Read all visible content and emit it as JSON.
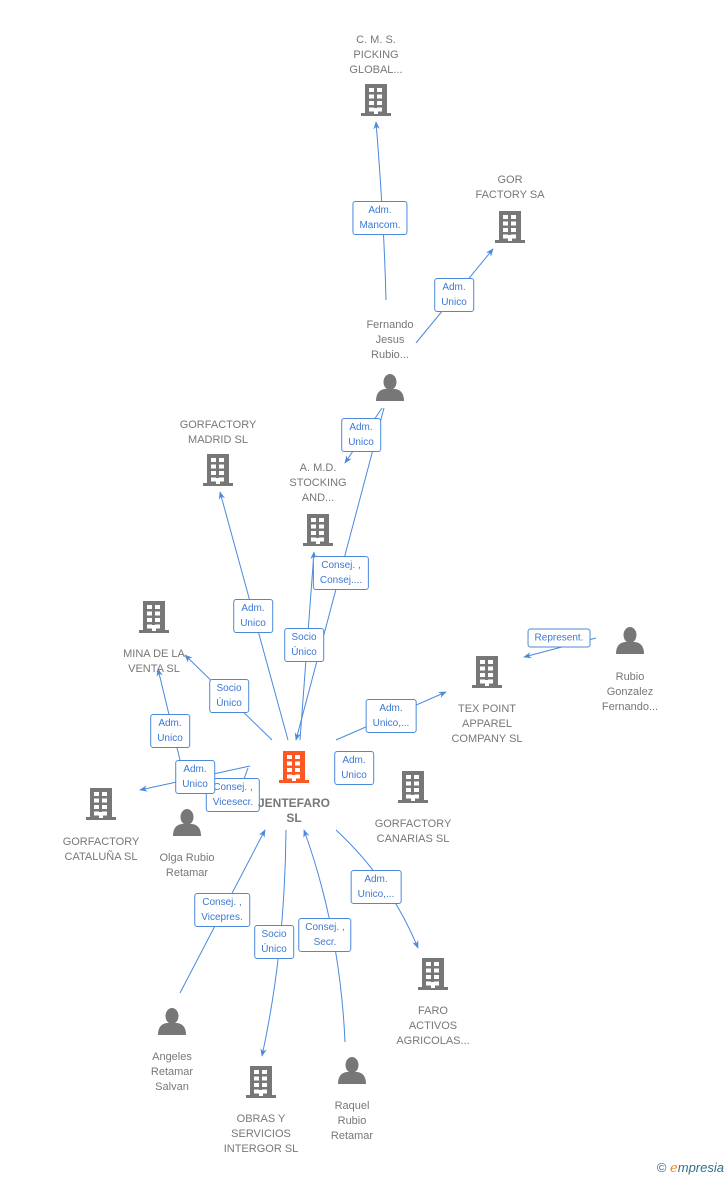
{
  "colors": {
    "edge": "#4a89dc",
    "node": "#777777",
    "center": "#ff5722"
  },
  "nodes": [
    {
      "label": "JENTEFARO\nSL",
      "type": "company",
      "icon": "building-icon",
      "center": true
    },
    {
      "label": "C.  M. S.\nPICKING\nGLOBAL...",
      "type": "company",
      "icon": "building-icon"
    },
    {
      "label": "GOR\nFACTORY SA",
      "type": "company",
      "icon": "building-icon"
    },
    {
      "label": "Fernando\nJesus\nRubio...",
      "type": "person",
      "icon": "person-icon"
    },
    {
      "label": "GORFACTORY\nMADRID  SL",
      "type": "company",
      "icon": "building-icon"
    },
    {
      "label": "A. M.D.\nSTOCKING\nAND...",
      "type": "company",
      "icon": "building-icon"
    },
    {
      "label": "MINA DE LA\nVENTA SL",
      "type": "company",
      "icon": "building-icon"
    },
    {
      "label": "TEX POINT\nAPPAREL\nCOMPANY  SL",
      "type": "company",
      "icon": "building-icon"
    },
    {
      "label": "Rubio\nGonzalez\nFernando...",
      "type": "person",
      "icon": "person-icon"
    },
    {
      "label": "GORFACTORY\nCATALUÑA  SL",
      "type": "company",
      "icon": "building-icon"
    },
    {
      "label": "Olga Rubio\nRetamar",
      "type": "person",
      "icon": "person-icon"
    },
    {
      "label": "GORFACTORY\nCANARIAS  SL",
      "type": "company",
      "icon": "building-icon"
    },
    {
      "label": "FARO\nACTIVOS\nAGRICOLAS...",
      "type": "company",
      "icon": "building-icon"
    },
    {
      "label": "Angeles\nRetamar\nSalvan",
      "type": "person",
      "icon": "person-icon"
    },
    {
      "label": "OBRAS Y\nSERVICIOS\nINTERGOR  SL",
      "type": "company",
      "icon": "building-icon"
    },
    {
      "label": "Raquel\nRubio\nRetamar",
      "type": "person",
      "icon": "person-icon"
    }
  ],
  "edges": [
    {
      "label": "Adm.\nMancom."
    },
    {
      "label": "Adm.\nUnico"
    },
    {
      "label": "Adm.\nUnico"
    },
    {
      "label": "Consej. ,\nConsej...."
    },
    {
      "label": "Adm.\nUnico"
    },
    {
      "label": "Socio\nÚnico"
    },
    {
      "label": "Socio\nÚnico"
    },
    {
      "label": "Adm.\nUnico"
    },
    {
      "label": "Consej. ,\nVicesecr."
    },
    {
      "label": "Adm.\nUnico"
    },
    {
      "label": "Adm.\nUnico,..."
    },
    {
      "label": "Represent."
    },
    {
      "label": "Adm.\nUnico"
    },
    {
      "label": "Adm.\nUnico,..."
    },
    {
      "label": "Consej. ,\nVicepres."
    },
    {
      "label": "Socio\nÚnico"
    },
    {
      "label": "Consej. ,\nSecr."
    }
  ],
  "footer": {
    "copyright": "©",
    "brand_e": "e",
    "brand_rest": "mpresia"
  }
}
